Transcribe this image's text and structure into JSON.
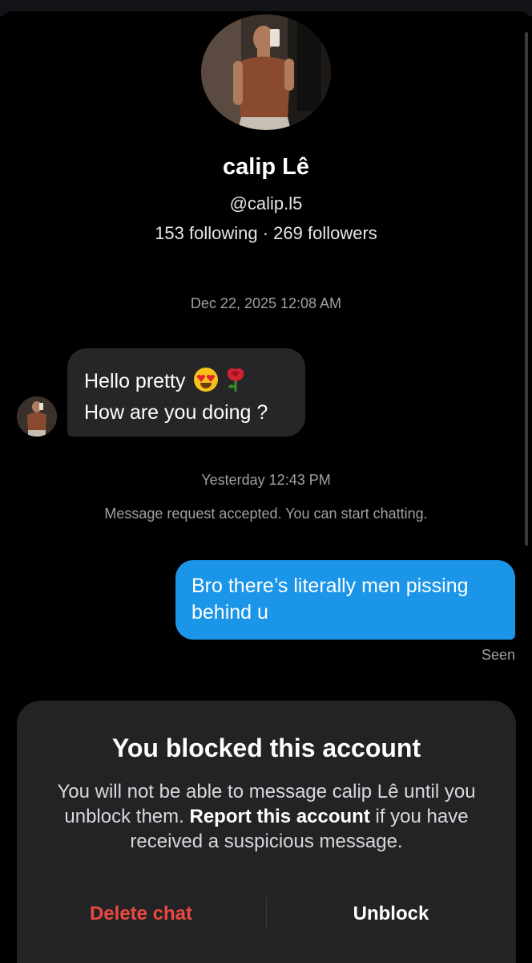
{
  "profile": {
    "name": "calip Lê",
    "handle": "@calip.l5",
    "stats": "153 following · 269 followers",
    "avatar_icon": "profile-photo"
  },
  "conversation": {
    "timestamp_1": "Dec 22, 2025 12:08 AM",
    "incoming_message": {
      "line1": "Hello pretty",
      "line1_emojis": [
        "heart-eyes-emoji",
        "rose-emoji"
      ],
      "line2": "How are you doing ?"
    },
    "timestamp_2": "Yesterday 12:43 PM",
    "notice": "Message request accepted. You can start chatting.",
    "outgoing_message": "Bro there’s literally men pissing behind u",
    "status": "Seen"
  },
  "block_panel": {
    "title": "You blocked this account",
    "desc_part1": "You will not be able to message calip Lê until you unblock them. ",
    "desc_link": "Report this account",
    "desc_part2": " if you have received a suspicious message.",
    "delete_label": "Delete chat",
    "unblock_label": "Unblock"
  },
  "colors": {
    "background": "#000000",
    "incoming_bubble": "#262628",
    "outgoing_bubble": "#1b95e8",
    "delete": "#e8483f",
    "panel": "#232325"
  }
}
